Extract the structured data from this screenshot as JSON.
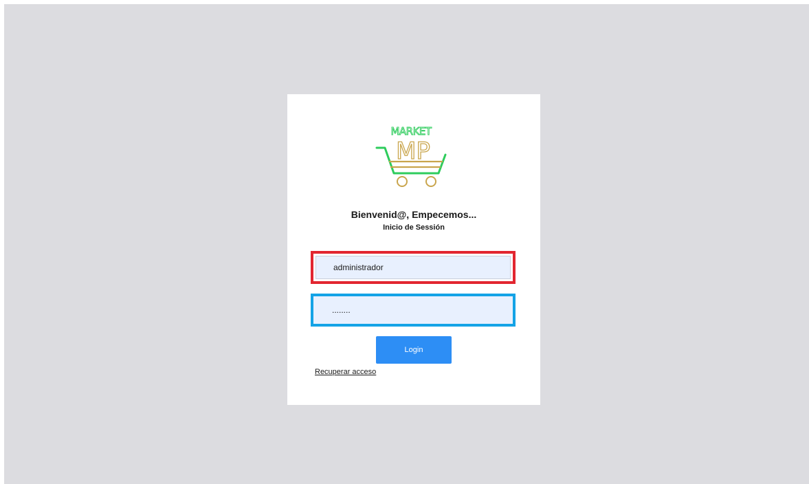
{
  "logo": {
    "wordmark": "MARKET",
    "monogram": "MP",
    "colors": {
      "green": "#2ecc5c",
      "gold": "#c9a54c"
    }
  },
  "login": {
    "welcome": "Bienvenid@, Empecemos...",
    "subtitle": "Inicio de Sessión",
    "username_value": "administrador",
    "password_value": "........",
    "login_label": "Login",
    "recover_label": "Recuperar acceso"
  },
  "colors": {
    "page_background": "#dcdce0",
    "username_frame": "#e22630",
    "password_frame": "#14a3e6",
    "button": "#2d8ef5",
    "input_fill": "#e8f0fe"
  }
}
